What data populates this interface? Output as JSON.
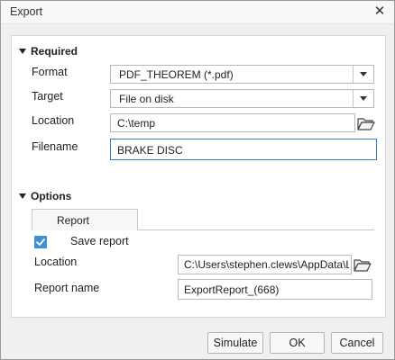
{
  "window": {
    "title": "Export",
    "close_glyph": "✕"
  },
  "required": {
    "heading": "Required",
    "format": {
      "label": "Format",
      "value": "PDF_THEOREM (*.pdf)"
    },
    "target": {
      "label": "Target",
      "value": "File on disk"
    },
    "location": {
      "label": "Location",
      "value": "C:\\temp",
      "browse_icon": "folder-open-icon"
    },
    "filename": {
      "label": "Filename",
      "value": "BRAKE DISC"
    }
  },
  "options": {
    "heading": "Options",
    "tabs": [
      {
        "label": "Report",
        "active": true
      }
    ],
    "save_report": {
      "label": "Save report",
      "checked": true
    },
    "location": {
      "label": "Location",
      "value": "C:\\Users\\stephen.clews\\AppData\\L",
      "browse_icon": "folder-open-icon"
    },
    "report_name": {
      "label": "Report name",
      "value": "ExportReport_(668)"
    }
  },
  "buttons": {
    "simulate": "Simulate",
    "ok": "OK",
    "cancel": "Cancel"
  },
  "colors": {
    "accent": "#3f8fd2",
    "focus_border": "#3b7fc4",
    "background": "#f0f0f0",
    "panel": "#ffffff"
  }
}
